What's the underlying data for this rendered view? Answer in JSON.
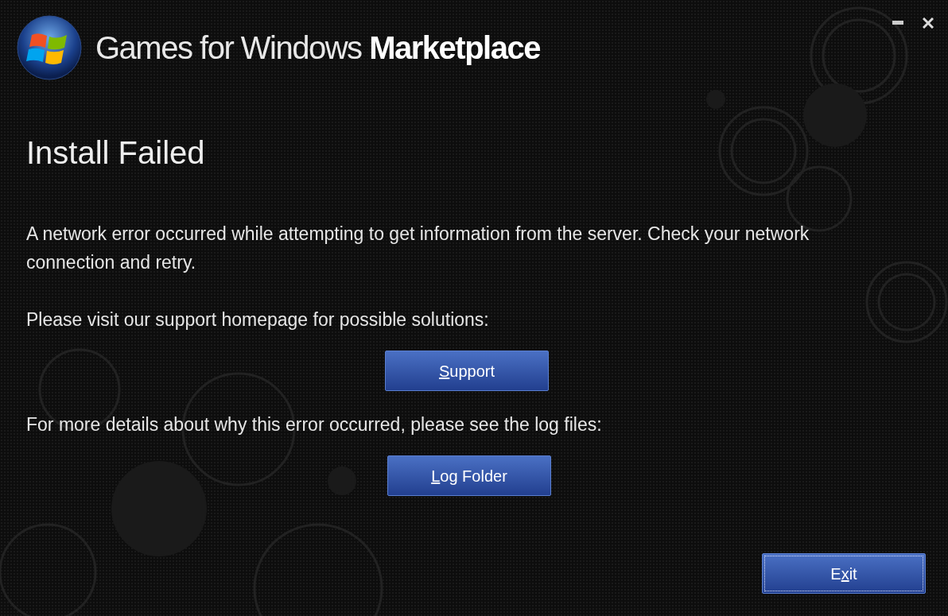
{
  "window": {
    "title": "Games for Windows **Marketplace**"
  },
  "heading": "Install Failed",
  "paragraphs": [
    {
      "kind": "text",
      "text": "A network error occurred while attempting to get information from the server. Check your network connection and retry."
    },
    {
      "kind": "text",
      "text": "Please visit our support homepage for possible solutions:"
    },
    {
      "kind": "button",
      "focused": false,
      "label_parts": [
        {
          "text": "S",
          "underlined": true
        },
        {
          "text": "upport",
          "underlined": false
        }
      ]
    },
    {
      "kind": "text",
      "text": "For more details about why this error occurred, please see the log files:"
    },
    {
      "kind": "button",
      "focused": false,
      "label_parts": [
        {
          "text": "L",
          "underlined": true
        },
        {
          "text": "og Folder",
          "underlined": false
        }
      ]
    }
  ],
  "footer_button": {
    "focused": true,
    "label_parts": [
      {
        "text": "E",
        "underlined": false
      },
      {
        "text": "x",
        "underlined": true
      },
      {
        "text": "it",
        "underlined": false
      }
    ]
  }
}
